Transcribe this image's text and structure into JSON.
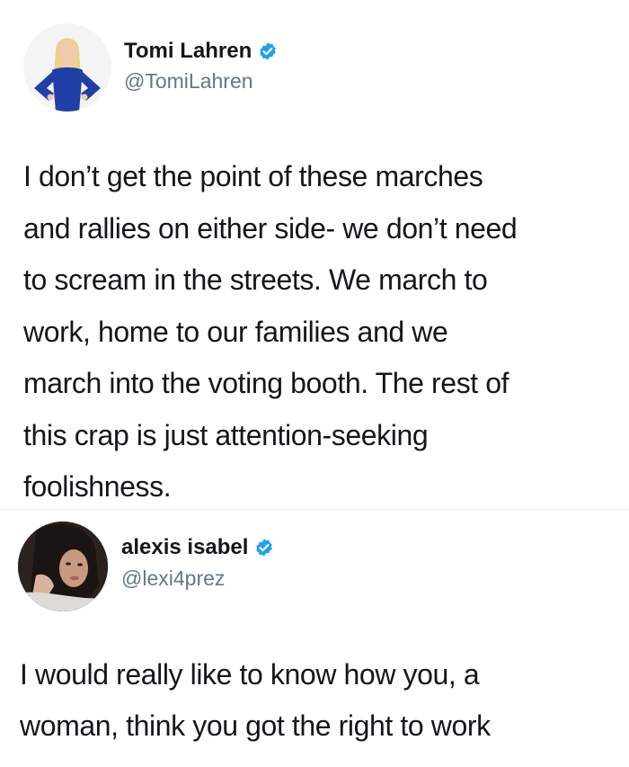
{
  "tweets": [
    {
      "display_name": "Tomi Lahren",
      "handle": "@TomiLahren",
      "verified": true,
      "avatar_icon": "profile-photo-woman-blonde-blue-dress",
      "text_lines": [
        "I don’t get the point of these marches",
        "and rallies on either side- we don’t need",
        "to scream in the streets. We march to",
        "work, home to our families and we",
        "march into the voting booth. The rest of",
        "this crap is just attention-seeking",
        "foolishness."
      ]
    },
    {
      "display_name": "alexis isabel",
      "handle": "@lexi4prez",
      "verified": true,
      "avatar_icon": "profile-photo-woman-dark-hair",
      "text_lines": [
        "I would really like to know how you, a",
        "woman, think you got the right to work"
      ]
    }
  ],
  "colors": {
    "verified_blue": "#1da1f2",
    "handle_gray": "#657786",
    "text": "#14171a",
    "divider": "#e6ecf0"
  }
}
